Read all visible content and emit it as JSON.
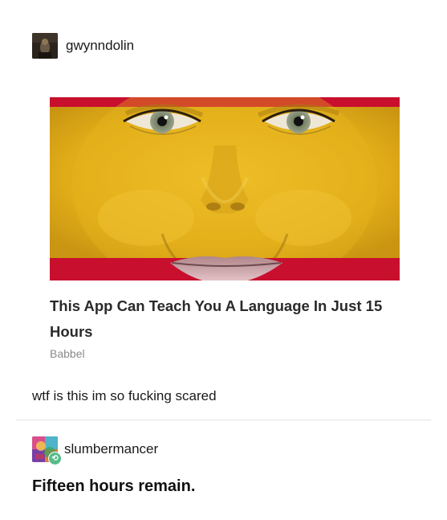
{
  "post": {
    "author": {
      "username": "gwynndolin",
      "avatar_icon": "avatar-image"
    },
    "ad": {
      "image_icon": "spain-flag-face-image",
      "headline": "This App Can Teach You A Language In Just 15 Hours",
      "source": "Babbel",
      "colors": {
        "flag_red": "#c8102e",
        "flag_yellow": "#e8b41a"
      }
    },
    "caption": "wtf is this im so fucking scared"
  },
  "reply": {
    "author": {
      "username": "slumbermancer",
      "avatar_icon": "avatar-image",
      "badge_icon": "reblog-icon",
      "badge_color": "#56bc8a"
    },
    "text": "Fifteen hours remain."
  }
}
